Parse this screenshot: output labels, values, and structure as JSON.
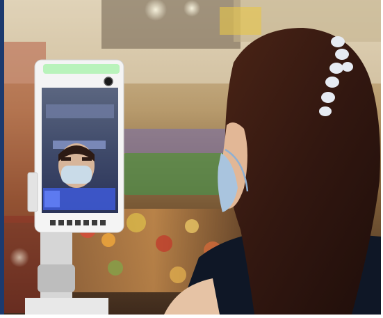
{
  "scene": {
    "subject": "woman-with-face-mask",
    "device": "face-recognition-temperature-kiosk",
    "setting": "supermarket"
  },
  "device_screen": {
    "line1": "",
    "line2": "",
    "panel_label": ""
  },
  "colors": {
    "border": "#1c3a6e",
    "device_body": "#f4f4f4",
    "screen_bg": "#3a4a7a",
    "mask": "#c9dbe8",
    "hair": "#3b1c12",
    "clip": "#e6ebf2"
  }
}
